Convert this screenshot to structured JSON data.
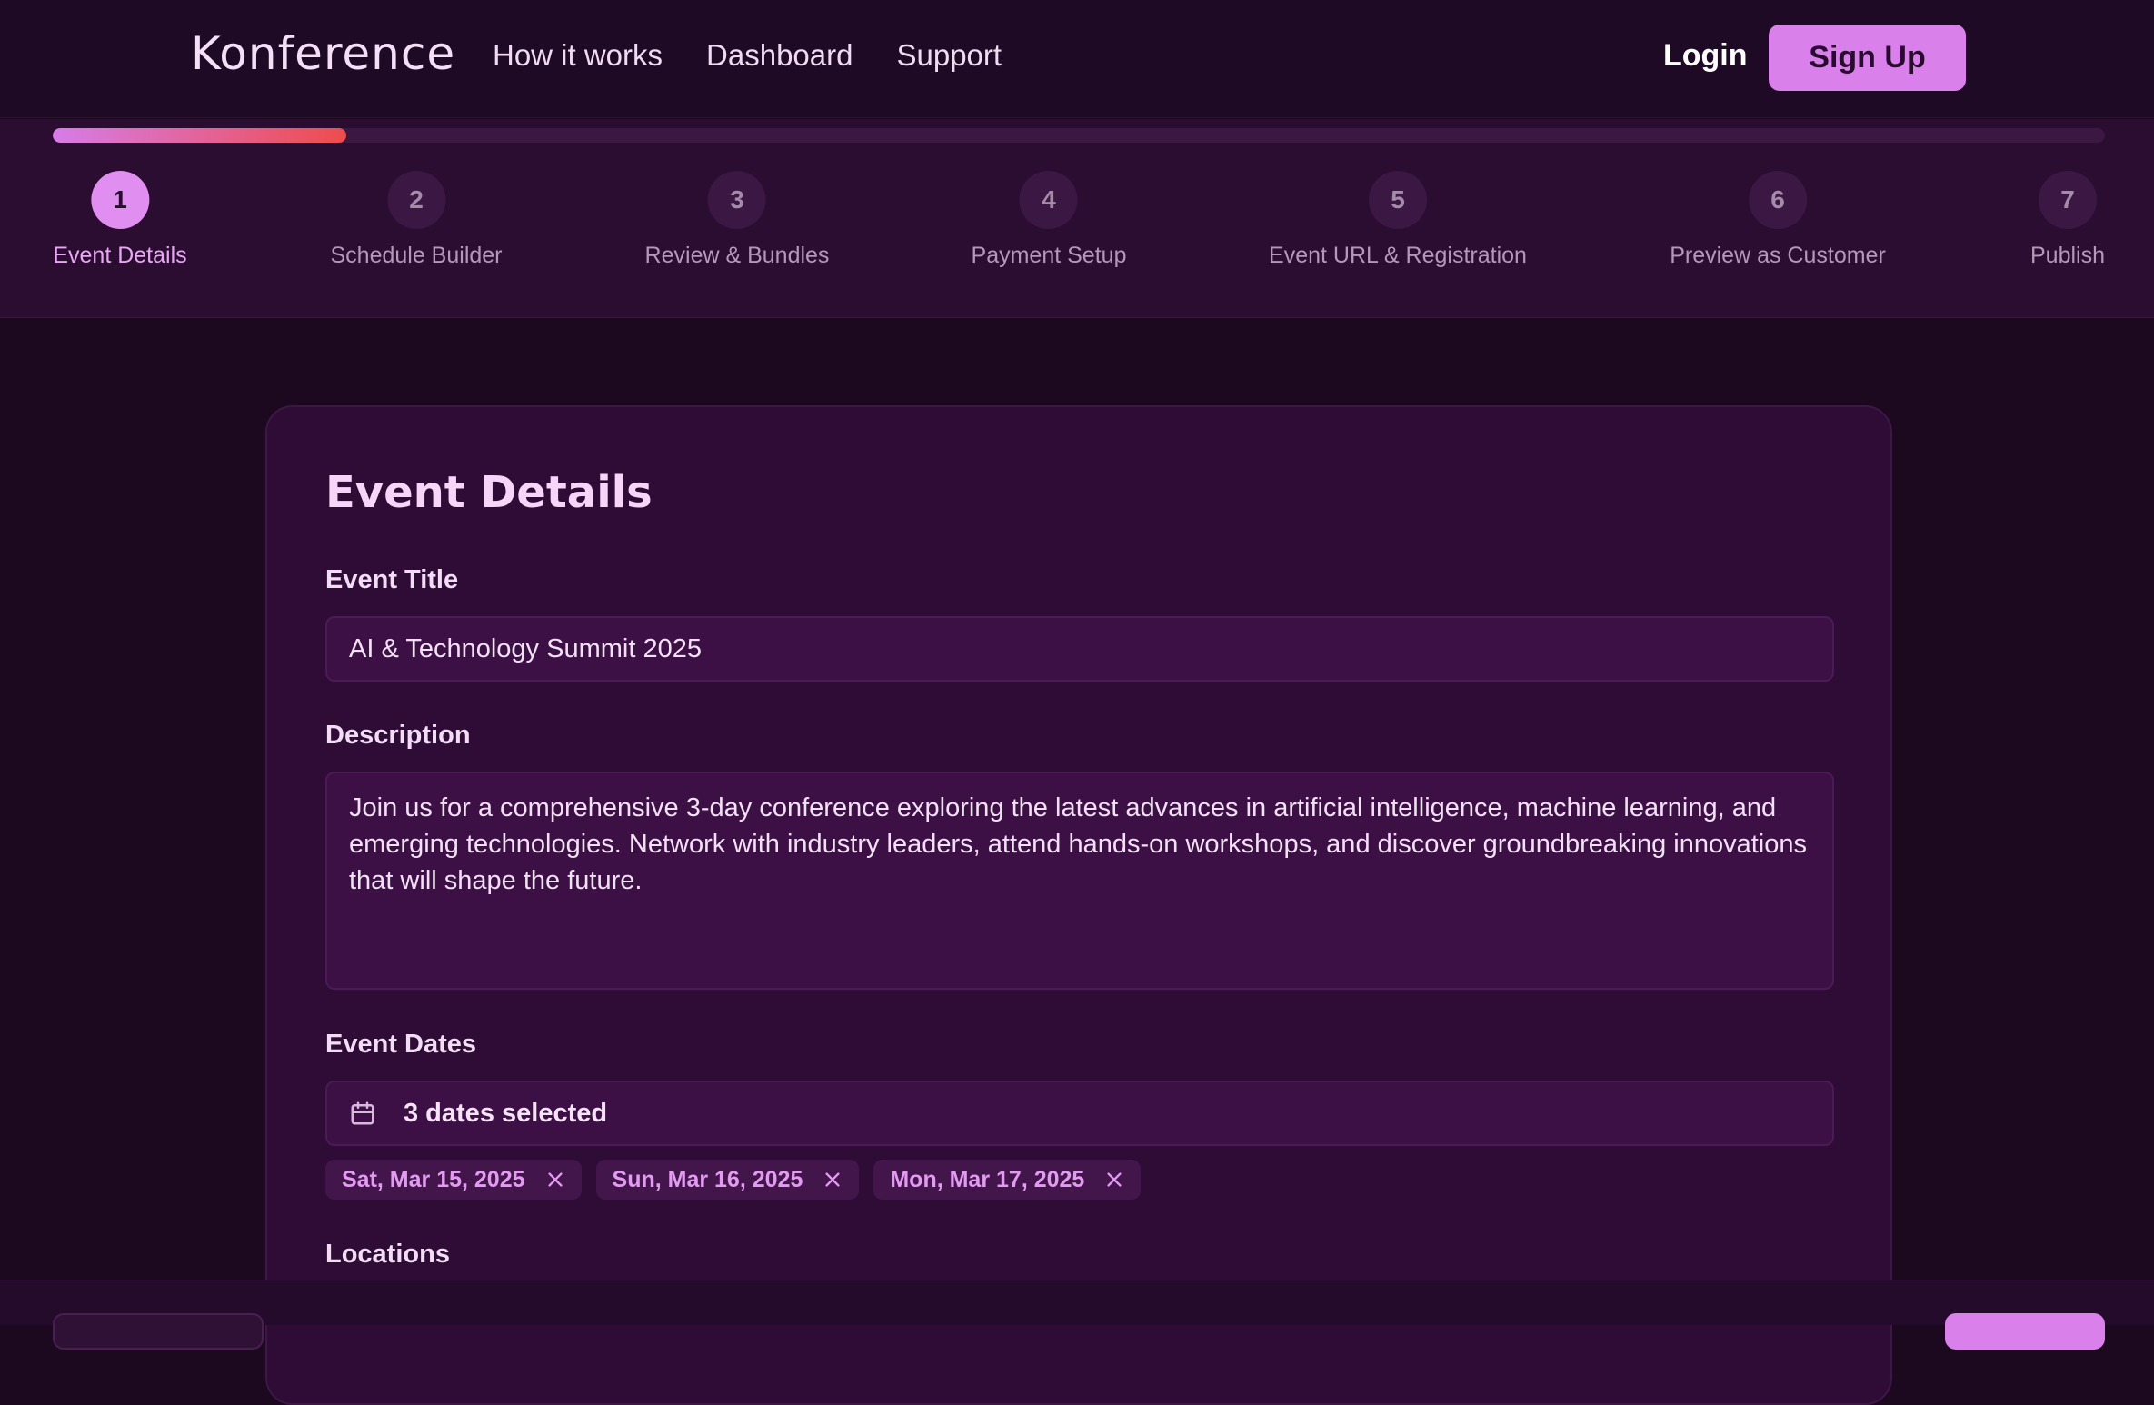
{
  "header": {
    "brand": "Konference",
    "nav": [
      "How it works",
      "Dashboard",
      "Support"
    ],
    "login_label": "Login",
    "signup_label": "Sign Up"
  },
  "stepper": {
    "progress_fraction": 0.143,
    "current_step": 1,
    "steps": [
      {
        "num": "1",
        "label": "Event Details"
      },
      {
        "num": "2",
        "label": "Schedule Builder"
      },
      {
        "num": "3",
        "label": "Review & Bundles"
      },
      {
        "num": "4",
        "label": "Payment Setup"
      },
      {
        "num": "5",
        "label": "Event URL & Registration"
      },
      {
        "num": "6",
        "label": "Preview as Customer"
      },
      {
        "num": "7",
        "label": "Publish"
      }
    ]
  },
  "form": {
    "title": "Event Details",
    "event_title_label": "Event Title",
    "event_title_value": "AI & Technology Summit 2025",
    "description_label": "Description",
    "description_value": "Join us for a comprehensive 3-day conference exploring the latest advances in artificial intelligence, machine learning, and emerging technologies. Network with industry leaders, attend hands-on workshops, and discover groundbreaking innovations that will shape the future.",
    "dates_label": "Event Dates",
    "dates_summary": "3 dates selected",
    "date_chips": [
      "Sat, Mar 15, 2025",
      "Sun, Mar 16, 2025",
      "Mon, Mar 17, 2025"
    ],
    "locations_label": "Locations"
  },
  "colors": {
    "accent": "#d980ea",
    "progress_end": "#ee4c4c",
    "background": "#1c0920"
  }
}
